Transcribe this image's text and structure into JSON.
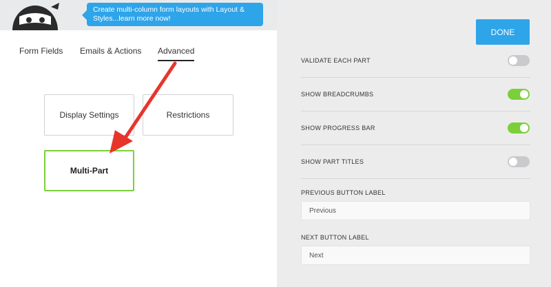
{
  "tooltip": {
    "line1": "Create multi-column form layouts with Layout &",
    "line2": "Styles...learn more now!"
  },
  "tabs": [
    {
      "label": "Form Fields"
    },
    {
      "label": "Emails & Actions"
    },
    {
      "label": "Advanced",
      "active": true
    }
  ],
  "cards": [
    {
      "label": "Display Settings"
    },
    {
      "label": "Restrictions"
    },
    {
      "label": "Multi-Part",
      "selected": true
    }
  ],
  "right_panel": {
    "done_label": "DONE",
    "settings": [
      {
        "label": "VALIDATE EACH PART",
        "enabled": false
      },
      {
        "label": "SHOW BREADCRUMBS",
        "enabled": true
      },
      {
        "label": "SHOW PROGRESS BAR",
        "enabled": true
      },
      {
        "label": "SHOW PART TITLES",
        "enabled": false
      }
    ],
    "previous_label": "PREVIOUS BUTTON LABEL",
    "previous_value": "Previous",
    "next_label": "NEXT BUTTON LABEL",
    "next_value": "Next"
  },
  "colors": {
    "accent": "#2ea4e9",
    "toggle_on": "#7bd03a",
    "toggle_off": "#c9cacc",
    "annotation_arrow": "#e8352b"
  },
  "icons": {
    "logo": "ninja-logo",
    "annotation": "arrow-annotation"
  }
}
